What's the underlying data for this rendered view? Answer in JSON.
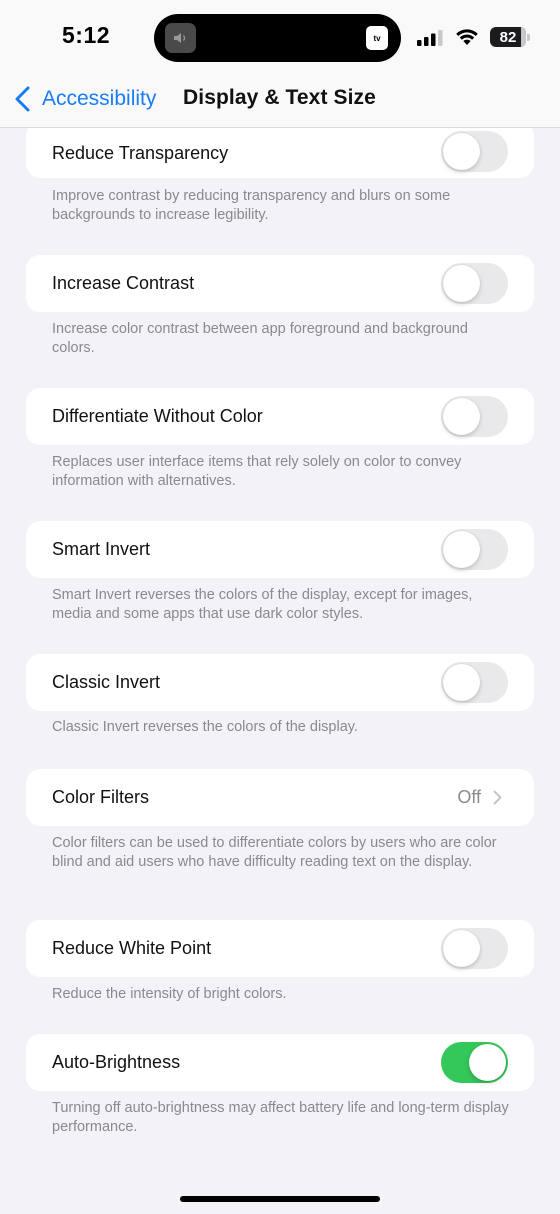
{
  "status_bar": {
    "time": "5:12",
    "battery_level": "82",
    "island_left_icon": "speaker-icon",
    "island_right_label": "tv"
  },
  "nav": {
    "back_label": "Accessibility",
    "title": "Display & Text Size"
  },
  "settings": [
    {
      "label": "Reduce Transparency",
      "type": "toggle",
      "on": false,
      "footer": "Improve contrast by reducing transparency and blurs on some backgrounds to increase legibility."
    },
    {
      "label": "Increase Contrast",
      "type": "toggle",
      "on": false,
      "footer": "Increase color contrast between app foreground and background colors."
    },
    {
      "label": "Differentiate Without Color",
      "type": "toggle",
      "on": false,
      "footer": "Replaces user interface items that rely solely on color to convey information with alternatives."
    },
    {
      "label": "Smart Invert",
      "type": "toggle",
      "on": false,
      "footer": "Smart Invert reverses the colors of the display, except for images, media and some apps that use dark color styles."
    },
    {
      "label": "Classic Invert",
      "type": "toggle",
      "on": false,
      "footer": "Classic Invert reverses the colors of the display."
    },
    {
      "label": "Color Filters",
      "type": "link",
      "value": "Off",
      "footer": "Color filters can be used to differentiate colors by users who are color blind and aid users who have difficulty reading text on the display."
    },
    {
      "label": "Reduce White Point",
      "type": "toggle",
      "on": false,
      "footer": "Reduce the intensity of bright colors."
    },
    {
      "label": "Auto-Brightness",
      "type": "toggle",
      "on": true,
      "footer": "Turning off auto-brightness may affect battery life and long-term display performance."
    }
  ],
  "colors": {
    "accent": "#1a7cf5",
    "toggle_on": "#34c759",
    "toggle_off": "#e9e9eb",
    "background": "#f2f2f7"
  }
}
